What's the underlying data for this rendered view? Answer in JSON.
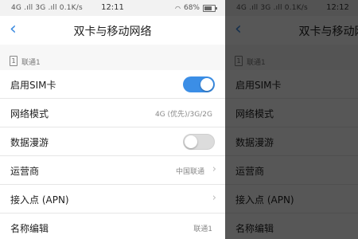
{
  "status": {
    "left": "4G .ıll 3G .ıll 0.1K/s",
    "time": "12:11",
    "battery": "68%",
    "right_time": "12:12"
  },
  "nav": {
    "back_icon": "chevron-left-icon",
    "title": "双卡与移动网络"
  },
  "section": {
    "sim_number": "1",
    "label": "联通1"
  },
  "rows": [
    {
      "label": "启用SIM卡",
      "toggle": true
    },
    {
      "label": "网络模式",
      "value": "4G (优先)/3G/2G"
    },
    {
      "label": "数据漫游",
      "toggle": false
    },
    {
      "label": "运营商",
      "value": "中国联通"
    },
    {
      "label": "接入点 (APN)"
    },
    {
      "label": "名称编辑",
      "value": "联通1"
    }
  ],
  "colors": {
    "accent": "#3b8ee6",
    "overlay": "rgba(0,0,0,0.66)"
  }
}
